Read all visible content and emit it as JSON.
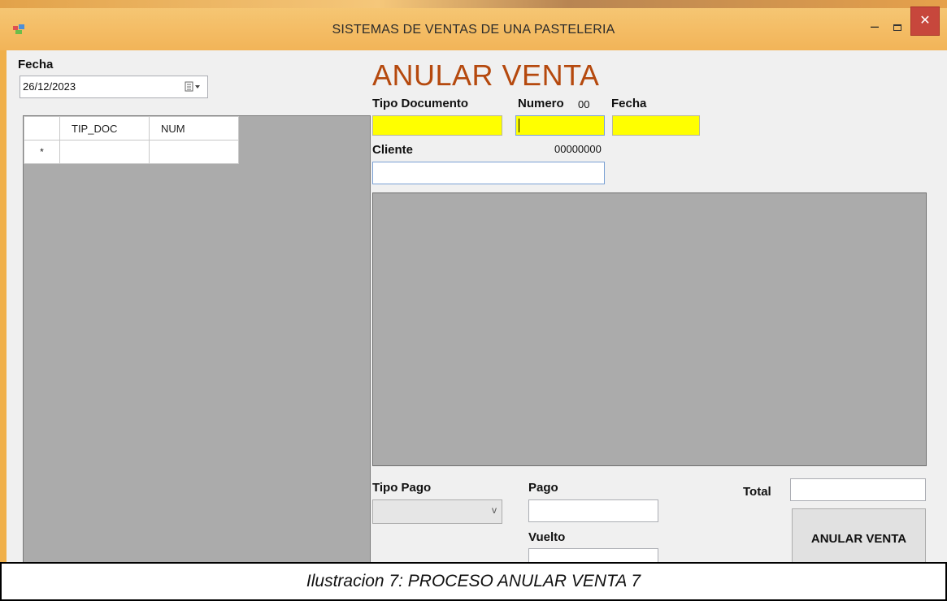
{
  "window": {
    "title": "SISTEMAS DE VENTAS DE UNA PASTELERIA"
  },
  "filter": {
    "date_label": "Fecha",
    "date_value": "26/12/2023"
  },
  "grid": {
    "columns": [
      "TIP_DOC",
      "NUM"
    ],
    "new_row_marker": "*"
  },
  "form": {
    "heading": "ANULAR VENTA",
    "tipo_documento_label": "Tipo Documento",
    "numero_label": "Numero",
    "numero_value": "00",
    "fecha_label": "Fecha",
    "cliente_label": "Cliente",
    "cliente_code": "00000000",
    "tipo_pago_label": "Tipo Pago",
    "pago_label": "Pago",
    "vuelto_label": "Vuelto",
    "total_label": "Total",
    "anular_button": "ANULAR VENTA"
  },
  "caption": "Ilustracion 7: PROCESO ANULAR VENTA 7",
  "colors": {
    "heading": "#b5490e",
    "required_field": "#ffff00",
    "titlebar": "#f2b458",
    "close_button": "#c7473c"
  }
}
